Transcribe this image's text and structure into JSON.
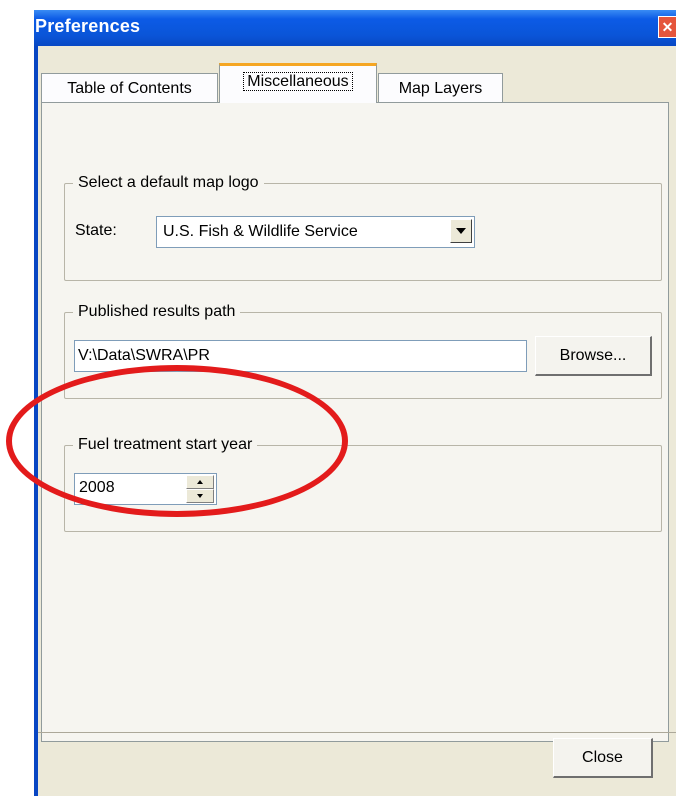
{
  "window": {
    "title": "Preferences",
    "close_glyph": "✕"
  },
  "tabs": [
    {
      "label": "Table of Contents",
      "active": false
    },
    {
      "label": "Miscellaneous",
      "active": true
    },
    {
      "label": "Map Layers",
      "active": false
    }
  ],
  "logo_group": {
    "title": "Select a default map logo",
    "state_label": "State:",
    "selected": "U.S. Fish & Wildlife Service"
  },
  "path_group": {
    "title": "Published results path",
    "value": "V:\\Data\\SWRA\\PR",
    "browse_label": "Browse..."
  },
  "year_group": {
    "title": "Fuel treatment start year",
    "value": "2008"
  },
  "footer": {
    "close_label": "Close"
  },
  "icons": {
    "close": "close-icon",
    "dropdown": "chevron-down-icon",
    "spin_up": "arrow-up-icon",
    "spin_down": "arrow-down-icon"
  },
  "colors": {
    "titlebar": "#0c5be6",
    "active_tab_accent": "#f5a623",
    "annotation": "#e31b1b",
    "dialog_bg": "#ece9d8"
  }
}
